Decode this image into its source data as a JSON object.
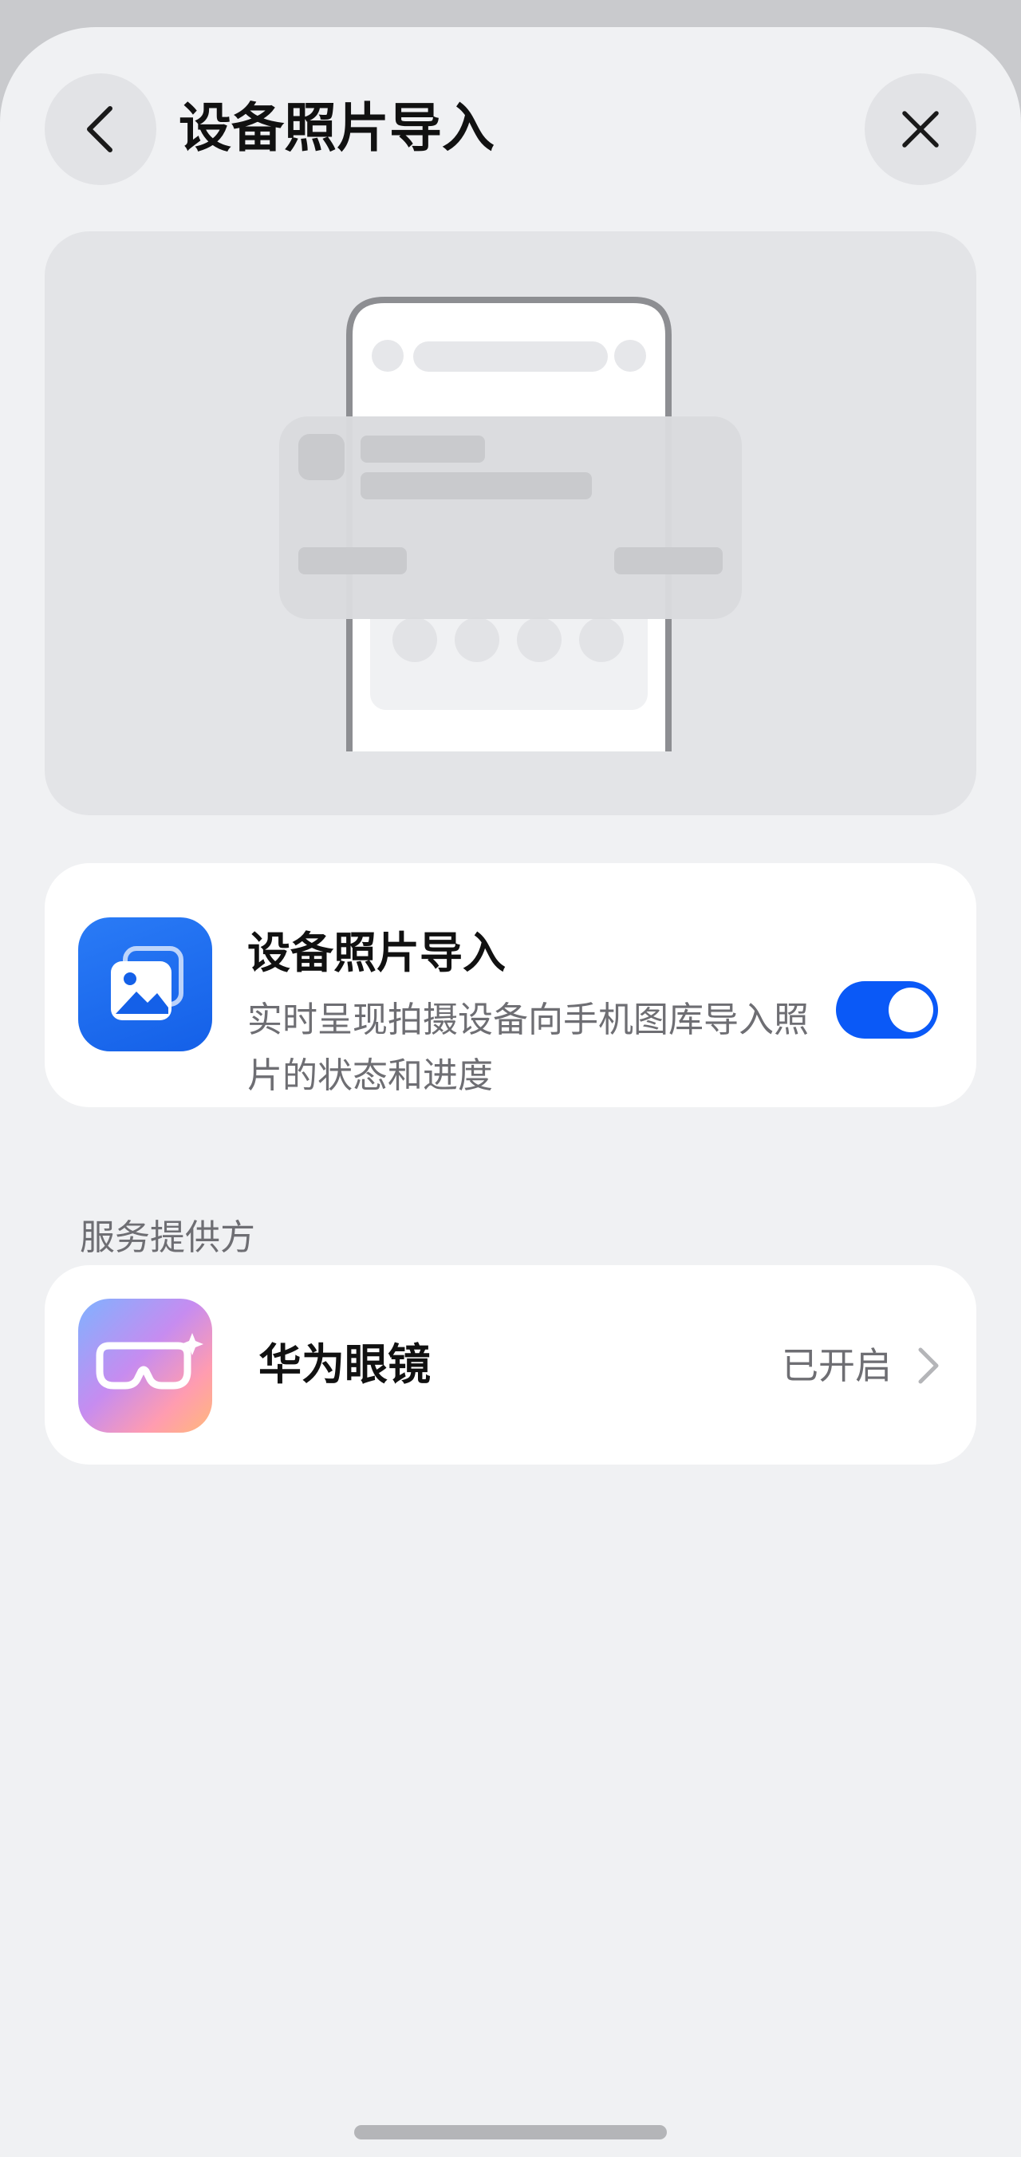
{
  "header": {
    "title": "设备照片导入",
    "back_icon": "chevron-left-icon",
    "close_icon": "close-icon"
  },
  "illustration": {
    "description_icon": "phone-notification-illustration"
  },
  "feature": {
    "icon": "photo-gallery-icon",
    "title": "设备照片导入",
    "description": "实时呈现拍摄设备向手机图库导入照片的状态和进度",
    "enabled": true
  },
  "providers": {
    "section_label": "服务提供方",
    "items": [
      {
        "icon": "huawei-glasses-icon",
        "name": "华为眼镜",
        "status": "已开启"
      }
    ]
  },
  "colors": {
    "accent": "#0a59f7",
    "background": "#f0f1f3",
    "card": "#ffffff",
    "secondary_text": "#6e6e73"
  }
}
